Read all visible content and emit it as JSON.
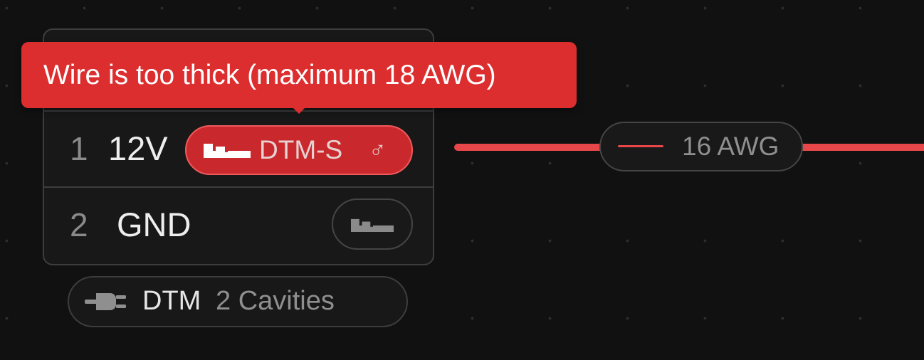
{
  "tooltip": {
    "message": "Wire is too thick (maximum 18 AWG)"
  },
  "connector": {
    "pins": [
      {
        "number": "1",
        "label": "12V",
        "terminal": "DTM-S",
        "terminal_gender_icon": "male-symbol-icon",
        "status": "error"
      },
      {
        "number": "2",
        "label": "GND",
        "terminal_icon": "terminal-icon"
      }
    ],
    "housing": {
      "icon": "plug-icon",
      "name": "DTM",
      "cavities": "2 Cavities"
    }
  },
  "wire": {
    "gauge": "16 AWG",
    "color": "#e8474a"
  },
  "colors": {
    "error": "#dc2e2f",
    "background": "#111111",
    "card": "#181818",
    "border": "#3d3d3d"
  }
}
